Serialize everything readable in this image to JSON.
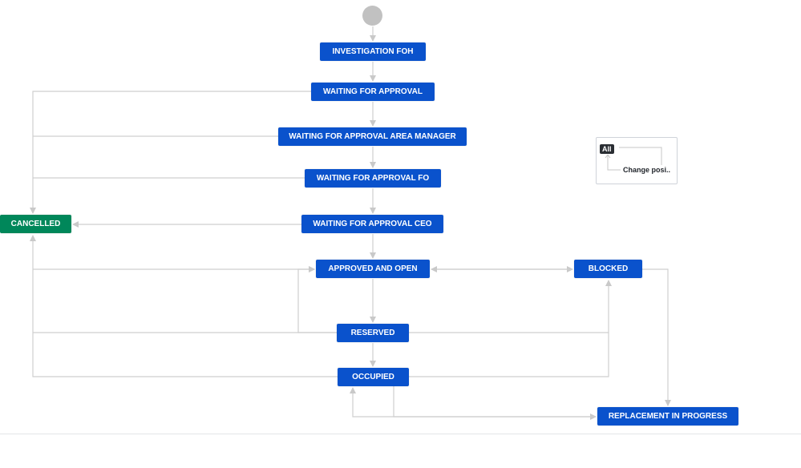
{
  "workflow": {
    "statuses": {
      "investigation": "INVESTIGATION FOH",
      "waiting_for_approval": "WAITING FOR APPROVAL",
      "waiting_for_approval_area_manager": "WAITING FOR APPROVAL AREA MANAGER",
      "waiting_for_approval_fo": "WAITING FOR APPROVAL FO",
      "waiting_for_approval_ceo": "WAITING FOR APPROVAL CEO",
      "cancelled": "CANCELLED",
      "approved_and_open": "APPROVED AND OPEN",
      "blocked": "BLOCKED",
      "reserved": "RESERVED",
      "occupied": "OCCUPIED",
      "replacement_in_progress": "REPLACEMENT IN PROGRESS"
    },
    "colors": {
      "status_blue": "#0a52cc",
      "status_green": "#00875a",
      "start_node": "#c1c1c1",
      "transition_line": "#cfcfcf"
    }
  },
  "legend": {
    "badge": "All",
    "text": "Change posi.."
  }
}
